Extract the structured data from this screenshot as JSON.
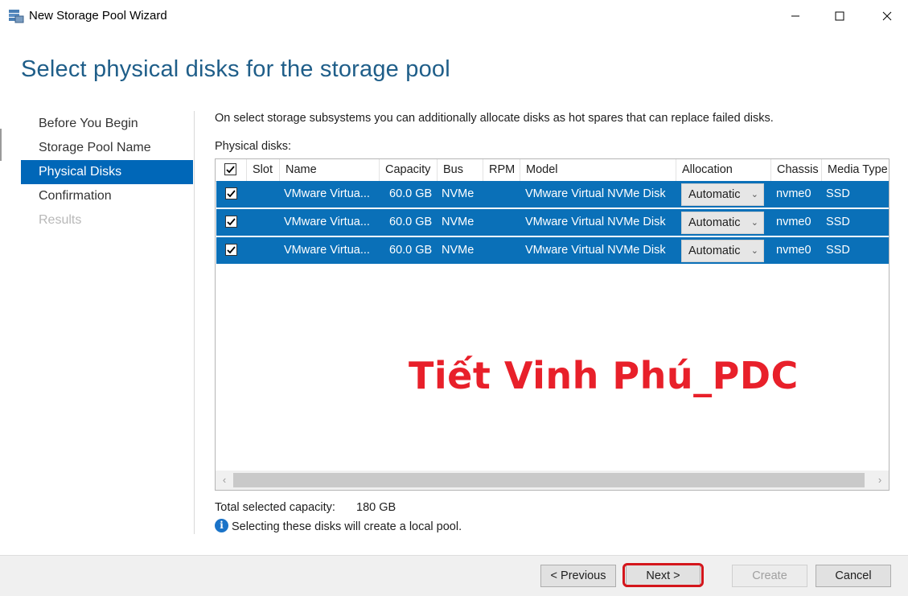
{
  "window": {
    "title": "New Storage Pool Wizard",
    "minimize_icon": "minimize-icon",
    "maximize_icon": "maximize-icon",
    "close_icon": "close-icon"
  },
  "heading": "Select physical disks for the storage pool",
  "nav": {
    "items": [
      {
        "label": "Before You Begin",
        "state": "normal"
      },
      {
        "label": "Storage Pool Name",
        "state": "normal"
      },
      {
        "label": "Physical Disks",
        "state": "active"
      },
      {
        "label": "Confirmation",
        "state": "normal"
      },
      {
        "label": "Results",
        "state": "disabled"
      }
    ]
  },
  "description": "On select storage subsystems you can additionally allocate disks as hot spares that can replace failed disks.",
  "physical_disks_label": "Physical disks:",
  "grid": {
    "columns": [
      "Slot",
      "Name",
      "Capacity",
      "Bus",
      "RPM",
      "Model",
      "Allocation",
      "Chassis",
      "Media Type"
    ],
    "header_checked": true,
    "rows": [
      {
        "checked": true,
        "slot": "",
        "name": "VMware Virtua...",
        "capacity": "60.0 GB",
        "bus": "NVMe",
        "rpm": "",
        "model": "VMware Virtual NVMe Disk",
        "allocation": "Automatic",
        "chassis": "nvme0",
        "media_type": "SSD"
      },
      {
        "checked": true,
        "slot": "",
        "name": "VMware Virtua...",
        "capacity": "60.0 GB",
        "bus": "NVMe",
        "rpm": "",
        "model": "VMware Virtual NVMe Disk",
        "allocation": "Automatic",
        "chassis": "nvme0",
        "media_type": "SSD"
      },
      {
        "checked": true,
        "slot": "",
        "name": "VMware Virtua...",
        "capacity": "60.0 GB",
        "bus": "NVMe",
        "rpm": "",
        "model": "VMware Virtual NVMe Disk",
        "allocation": "Automatic",
        "chassis": "nvme0",
        "media_type": "SSD"
      }
    ]
  },
  "watermark": "Tiết Vinh Phú_PDC",
  "total": {
    "label": "Total selected capacity:",
    "value": "180 GB"
  },
  "info": {
    "icon": "info-icon",
    "text": "Selecting these disks will create a local pool."
  },
  "buttons": {
    "previous": "< Previous",
    "next": "Next >",
    "create": "Create",
    "cancel": "Cancel"
  },
  "colors": {
    "accent": "#0067b8",
    "heading": "#1f5e89",
    "highlight": "#d4161c",
    "watermark": "#e8202a"
  }
}
